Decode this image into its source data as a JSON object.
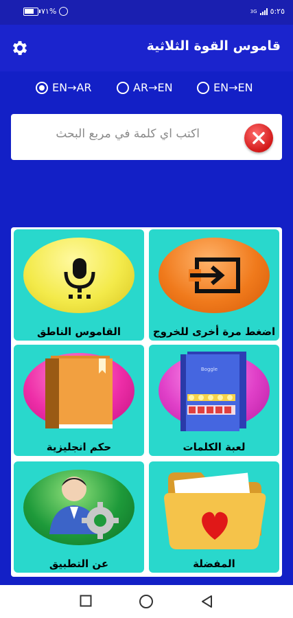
{
  "status_bar": {
    "battery_percent": "٧١%",
    "battery_level": 0.71,
    "network": "3G",
    "time": "٥:٢٥"
  },
  "app_bar": {
    "title": "قاموس القوة الثلاثية",
    "settings_icon": "gear-icon"
  },
  "modes": [
    {
      "label": "EN→AR",
      "checked": true
    },
    {
      "label": "AR→EN",
      "checked": false
    },
    {
      "label": "EN→EN",
      "checked": false
    }
  ],
  "search": {
    "placeholder": "اكتب اي كلمة في مربع البحث",
    "value": "",
    "clear_icon": "close-icon"
  },
  "tiles": [
    {
      "label": "اضغط مرة أخرى للخروج",
      "icon": "exit-icon",
      "color": "#f07a1c"
    },
    {
      "label": "القاموس الناطق",
      "icon": "microphone-icon",
      "color": "#f3ea4a"
    },
    {
      "label": "لعبة الكلمات",
      "icon": "word-game-book-icon",
      "color": "#e040c8"
    },
    {
      "label": "حكم انجليزية",
      "icon": "book-icon",
      "color": "#ee2ea8"
    },
    {
      "label": "المفضلة",
      "icon": "heart-folder-icon",
      "color": "#f5c34a"
    },
    {
      "label": "عن التطبيق",
      "icon": "user-gear-icon",
      "color": "#1e9a3a"
    }
  ],
  "nav": {
    "recents_icon": "square-icon",
    "home_icon": "circle-icon",
    "back_icon": "triangle-back-icon"
  },
  "colors": {
    "background": "#1320c6",
    "tile": "#29d8cc",
    "clear": "#d21919"
  }
}
